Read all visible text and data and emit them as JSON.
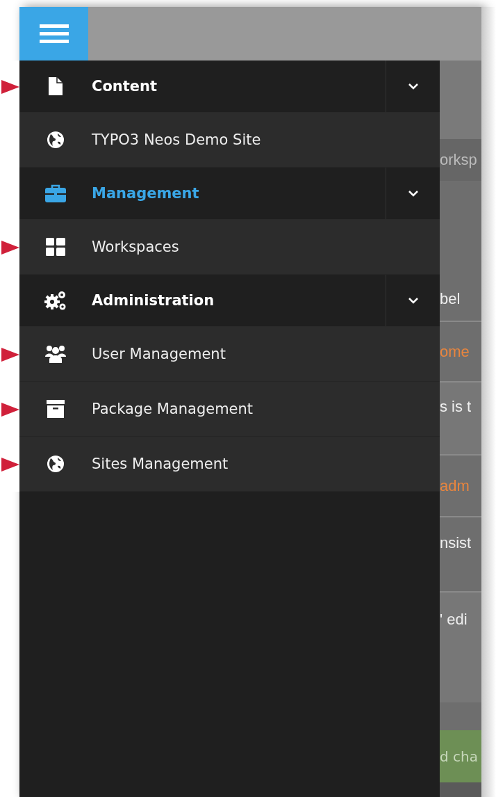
{
  "menu_button": {
    "active": true
  },
  "sections": [
    {
      "title": "Content",
      "active": false,
      "expanded": true,
      "marked": true,
      "items": [
        {
          "label": "TYPO3 Neos Demo Site",
          "marked": false
        }
      ]
    },
    {
      "title": "Management",
      "active": true,
      "expanded": true,
      "marked": false,
      "items": [
        {
          "label": "Workspaces",
          "marked": true
        }
      ]
    },
    {
      "title": "Administration",
      "active": false,
      "expanded": true,
      "marked": false,
      "items": [
        {
          "label": "User Management",
          "marked": true
        },
        {
          "label": "Package Management",
          "marked": true
        },
        {
          "label": "Sites Management",
          "marked": true
        }
      ]
    }
  ],
  "background_fragments": [
    {
      "text": "orksp",
      "kind": "tab"
    },
    {
      "text": "bel",
      "kind": "text"
    },
    {
      "text": "ome",
      "kind": "link"
    },
    {
      "text": "s is t",
      "kind": "text"
    },
    {
      "text": "adm",
      "kind": "link"
    },
    {
      "text": "nsist",
      "kind": "text"
    },
    {
      "text": "' edi",
      "kind": "text"
    },
    {
      "text": "d cha",
      "kind": "button"
    }
  ]
}
